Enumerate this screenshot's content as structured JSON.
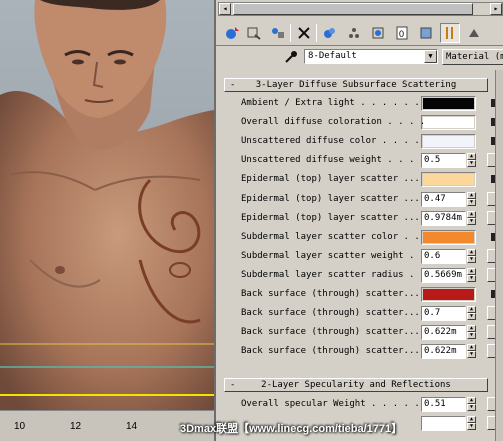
{
  "viewport": {
    "timeline_ticks": [
      "10",
      "12",
      "14"
    ]
  },
  "watermark": "3Dmax联盟【www.linecg.com/tieba/1771】",
  "toolbar": {
    "icons": [
      "get-material-icon",
      "put-to-scene-icon",
      "assign-material-icon",
      "reset-icon",
      "copy-material-icon",
      "make-unique-icon",
      "put-to-library-icon",
      "material-effects-channel-icon",
      "show-map-icon",
      "show-end-result-icon",
      "go-to-parent-icon"
    ]
  },
  "material": {
    "name": "8-Default",
    "type_button": "Material (mi"
  },
  "rollout1": {
    "sign": "-",
    "title": "3-Layer Diffuse Subsurface Scattering",
    "rows": [
      {
        "label": "Ambient / Extra light . . . . . . .",
        "kind": "color",
        "color": "#050505"
      },
      {
        "label": "Overall diffuse coloration . . . .",
        "kind": "color",
        "color": "#ffffff"
      },
      {
        "label": "Unscattered diffuse color . . . . .",
        "kind": "color",
        "color": "#f2f3fb"
      },
      {
        "label": "Unscattered diffuse weight . . . .",
        "kind": "value",
        "value": "0.5"
      },
      {
        "label": "Epidermal (top) layer scatter ...",
        "kind": "color",
        "color": "#fcd79a"
      },
      {
        "label": "Epidermal (top) layer scatter ...",
        "kind": "value",
        "value": "0.47"
      },
      {
        "label": "Epidermal (top) layer scatter ...",
        "kind": "value",
        "value": "0.9784m"
      },
      {
        "label": "Subdermal layer scatter color . .",
        "kind": "color",
        "color": "#f2892c"
      },
      {
        "label": "Subdermal layer scatter weight . .",
        "kind": "value",
        "value": "0.6"
      },
      {
        "label": "Subdermal layer scatter radius . .",
        "kind": "value",
        "value": "0.5669m"
      },
      {
        "label": "Back surface (through) scatter...",
        "kind": "color",
        "color": "#b81a1a"
      },
      {
        "label": "Back surface (through) scatter...",
        "kind": "value",
        "value": "0.7"
      },
      {
        "label": "Back surface (through) scatter...",
        "kind": "value",
        "value": "0.622m"
      },
      {
        "label": "Back surface (through) scatter...",
        "kind": "value",
        "value": "0.622m"
      }
    ]
  },
  "rollout2": {
    "sign": "-",
    "title": "2-Layer Specularity and Reflections",
    "rows": [
      {
        "label": "Overall specular Weight . . . . .",
        "kind": "value",
        "value": "0.51"
      },
      {
        "label": "",
        "kind": "value",
        "value": ""
      }
    ]
  }
}
